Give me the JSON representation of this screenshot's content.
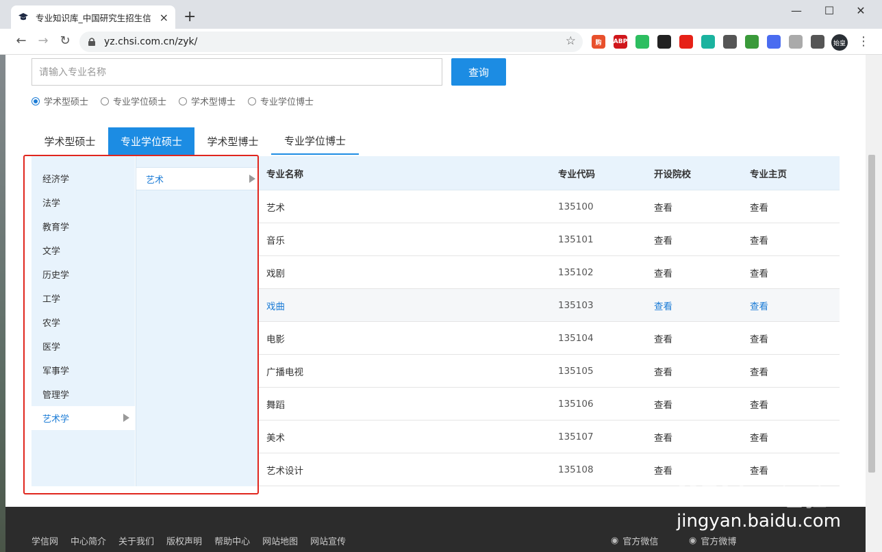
{
  "browser": {
    "tab_title": "专业知识库_中国研究生招生信",
    "tab_close": "×",
    "new_tab": "+",
    "url": "yz.chsi.com.cn/zyk/",
    "profile_label": "始皇",
    "extensions": [
      {
        "name": "gou-extension",
        "label": "购",
        "color": "#e8502c"
      },
      {
        "name": "adblock-extension",
        "label": "ABP",
        "color": "#d0161b"
      },
      {
        "name": "evernote-extension",
        "label": "",
        "color": "#2dbe60"
      },
      {
        "name": "extension-4",
        "label": "",
        "color": "#222"
      },
      {
        "name": "youtube-extension",
        "label": "",
        "color": "#e62117"
      },
      {
        "name": "sync-extension",
        "label": "",
        "color": "#1bb39f"
      },
      {
        "name": "bulb-extension",
        "label": "",
        "color": "#555"
      },
      {
        "name": "globe-extension",
        "label": "",
        "color": "#3a9a3a"
      },
      {
        "name": "bookmark-extension",
        "label": "",
        "color": "#4a6cf0"
      },
      {
        "name": "check-extension",
        "label": "",
        "color": "#aaa"
      },
      {
        "name": "puzzle-extension",
        "label": "",
        "color": "#555"
      }
    ]
  },
  "search": {
    "placeholder": "请输入专业名称",
    "button": "查询"
  },
  "radio_options": [
    {
      "label": "学术型硕士",
      "checked": true
    },
    {
      "label": "专业学位硕士",
      "checked": false
    },
    {
      "label": "学术型博士",
      "checked": false
    },
    {
      "label": "专业学位博士",
      "checked": false
    }
  ],
  "degree_tabs": [
    {
      "label": "学术型硕士",
      "active": false
    },
    {
      "label": "专业学位硕士",
      "active": true
    },
    {
      "label": "学术型博士",
      "active": false
    },
    {
      "label": "专业学位博士",
      "active": false
    }
  ],
  "categories": [
    "经济学",
    "法学",
    "教育学",
    "文学",
    "历史学",
    "工学",
    "农学",
    "医学",
    "军事学",
    "管理学",
    "艺术学"
  ],
  "active_category": "艺术学",
  "subcategory": "艺术",
  "table": {
    "headers": [
      "专业名称",
      "专业代码",
      "开设院校",
      "专业主页"
    ],
    "rows": [
      {
        "name": "艺术",
        "code": "135100",
        "schools": "查看",
        "home": "查看"
      },
      {
        "name": "音乐",
        "code": "135101",
        "schools": "查看",
        "home": "查看"
      },
      {
        "name": "戏剧",
        "code": "135102",
        "schools": "查看",
        "home": "查看"
      },
      {
        "name": "戏曲",
        "code": "135103",
        "schools": "查看",
        "home": "查看"
      },
      {
        "name": "电影",
        "code": "135104",
        "schools": "查看",
        "home": "查看"
      },
      {
        "name": "广播电视",
        "code": "135105",
        "schools": "查看",
        "home": "查看"
      },
      {
        "name": "舞蹈",
        "code": "135106",
        "schools": "查看",
        "home": "查看"
      },
      {
        "name": "美术",
        "code": "135107",
        "schools": "查看",
        "home": "查看"
      },
      {
        "name": "艺术设计",
        "code": "135108",
        "schools": "查看",
        "home": "查看"
      }
    ],
    "highlighted_row": 3
  },
  "footer": {
    "links": [
      "学信网",
      "中心简介",
      "关于我们",
      "版权声明",
      "帮助中心",
      "网站地图",
      "网站宣传"
    ],
    "wechat": "官方微信",
    "weibo": "官方微博"
  },
  "watermark": {
    "logo_bai": "Bai",
    "logo_du": "du",
    "logo_cn": "经验",
    "url": "jingyan.baidu.com"
  },
  "colors": {
    "accent": "#1c8ce3",
    "highlight_box": "#e0251d"
  }
}
